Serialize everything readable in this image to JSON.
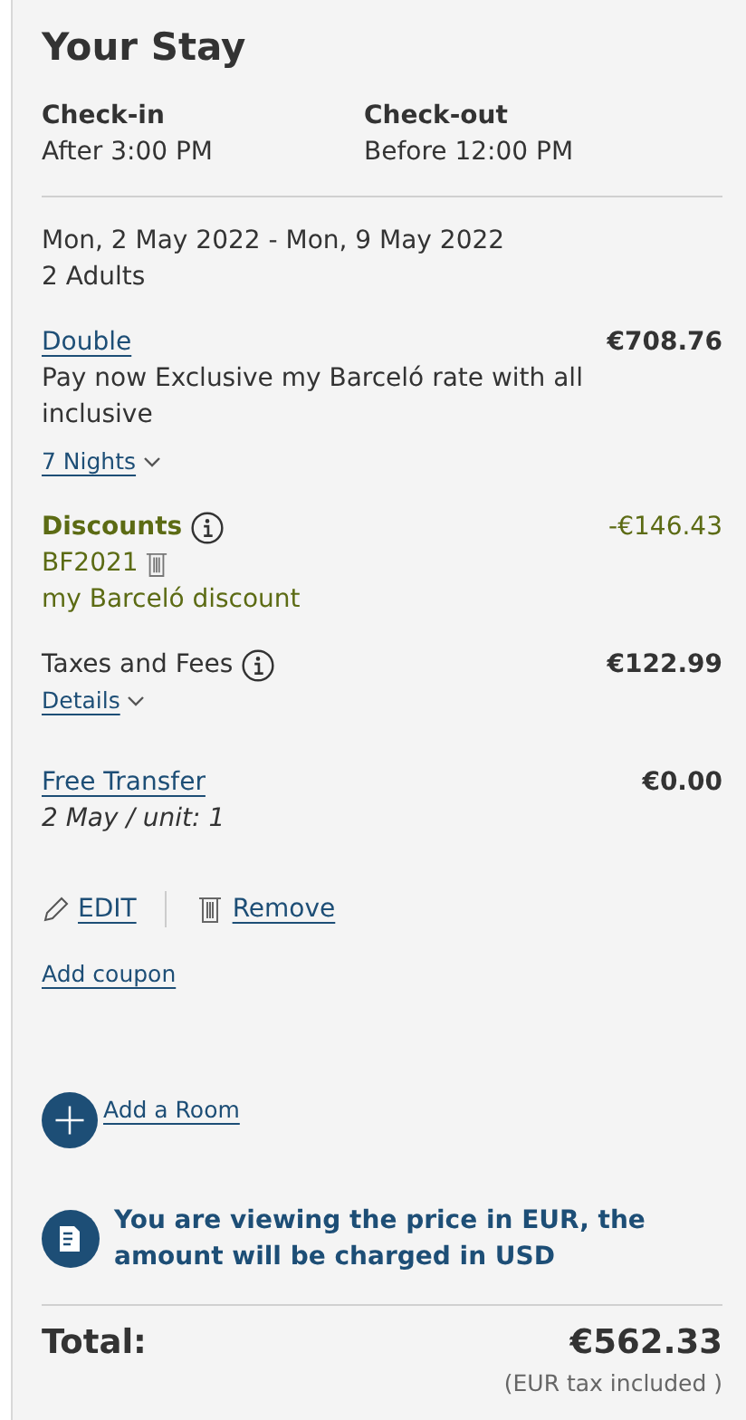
{
  "title": "Your Stay",
  "times": [
    {
      "label": "Check-in",
      "value": "After 3:00 PM"
    },
    {
      "label": "Check-out",
      "value": "Before 12:00 PM"
    }
  ],
  "dates": "Mon, 2 May 2022 - Mon, 9 May 2022",
  "guests": "2 Adults",
  "room": {
    "name": "Double",
    "price": "€708.76",
    "rate": "Pay now Exclusive my Barceló rate with all inclusive",
    "nights": "7 Nights"
  },
  "discounts": {
    "label": "Discounts",
    "amount": "-€146.43",
    "code": "BF2021",
    "description": "my Barceló discount"
  },
  "taxes": {
    "label": "Taxes and Fees",
    "amount": "€122.99",
    "details": "Details"
  },
  "transfer": {
    "name": "Free Transfer",
    "price": "€0.00",
    "note": "2 May / unit: 1"
  },
  "actions": [
    "EDIT",
    "Remove"
  ],
  "add_coupon": "Add coupon",
  "add_room": "Add a Room",
  "notice": "You are viewing the price in EUR, the amount will be charged in USD",
  "total": {
    "label": "Total:",
    "amount": "€562.33",
    "note": "(EUR tax included )"
  }
}
